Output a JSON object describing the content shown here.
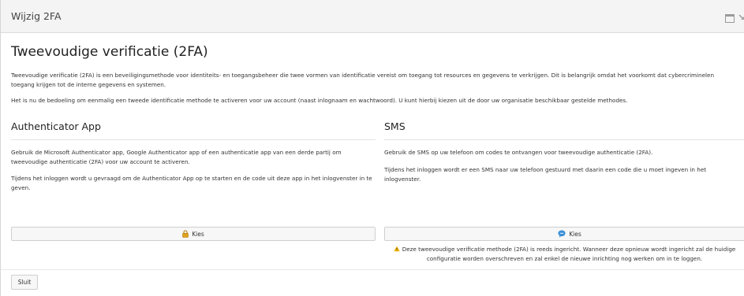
{
  "window": {
    "title": "Wijzig 2FA",
    "maximize_icon": "maximize-icon",
    "close_icon": "close-icon"
  },
  "main": {
    "heading": "Tweevoudige verificatie (2FA)",
    "intro_1": "Tweevoudige verificatie (2FA) is een beveiligingsmethode voor identiteits- en toegangsbeheer die twee vormen van identificatie vereist om toegang tot resources en gegevens te verkrijgen. Dit is belangrijk omdat het voorkomt dat cybercriminelen toegang krijgen tot de interne gegevens en systemen.",
    "intro_2": "Het is nu de bedoeling om eenmalig een tweede identificatie methode te activeren voor uw account (naast inlognaam en wachtwoord). U kunt hierbij kiezen uit de door uw organisatie beschikbaar gestelde methodes."
  },
  "authenticator": {
    "title": "Authenticator App",
    "text_1": "Gebruik de Microsoft Authenticator app, Google Authenticator app of een authenticatie app van een derde partij om tweevoudige authenticatie (2FA) voor uw account te activeren.",
    "text_2": "Tijdens het inloggen wordt u gevraagd om de Authenticator App op te starten en de code uit deze app in het inlogvenster in te geven.",
    "button_label": "Kies",
    "button_icon": "lock-icon"
  },
  "sms": {
    "title": "SMS",
    "text_1": "Gebruik de SMS op uw telefoon om codes te ontvangen voor tweevoudige authenticatie (2FA).",
    "text_2": "Tijdens het inloggen wordt er een SMS naar uw telefoon gestuurd met daarin een code die u moet ingeven in het inlogvenster.",
    "button_label": "Kies",
    "button_icon": "chat-bubble-icon",
    "warning_icon": "warning-icon",
    "warning_line_1": "Deze tweevoudige verificatie methode (2FA) is reeds ingericht. Wanneer deze opnieuw wordt ingericht zal de huidige",
    "warning_line_2": "configuratie worden overschreven en zal enkel de nieuwe inrichting nog werken om in te loggen."
  },
  "footer": {
    "close_label": "Sluit"
  },
  "colors": {
    "lock": "#e0a21c",
    "chat": "#3a8fd6",
    "warning": "#f0b400"
  }
}
